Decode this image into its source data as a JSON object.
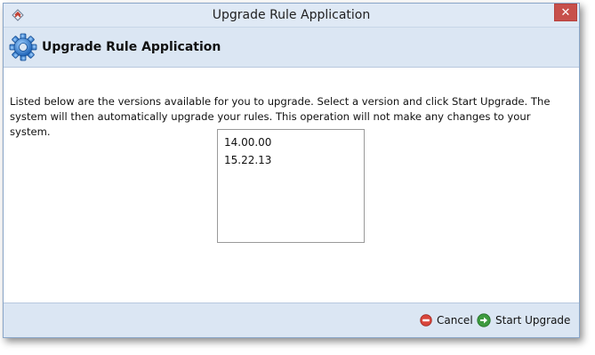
{
  "window": {
    "title": "Upgrade Rule Application",
    "close_label": "✕"
  },
  "header": {
    "title": "Upgrade Rule Application"
  },
  "main": {
    "description": "Listed below are the versions available for you to upgrade. Select a version and click Start Upgrade. The system will then automatically upgrade your rules. This operation will not make any changes to your system.",
    "versions": [
      "14.00.00",
      "15.22.13"
    ]
  },
  "footer": {
    "cancel_label": "Cancel",
    "start_label": "Start Upgrade"
  },
  "colors": {
    "header_bg": "#dbe6f3",
    "close_red": "#c7504b",
    "cancel_icon": "#d9453b",
    "start_icon": "#3d9a3f"
  }
}
